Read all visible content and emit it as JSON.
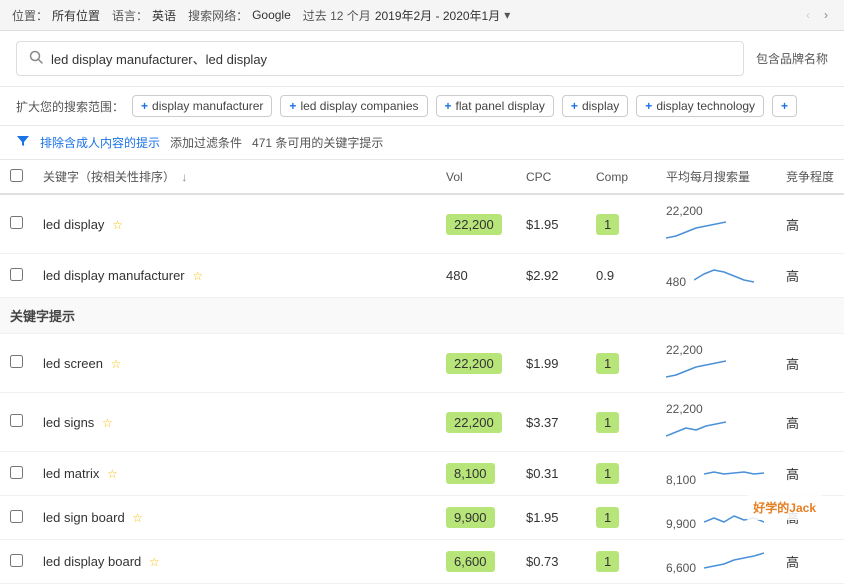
{
  "topbar": {
    "location_label": "位置：",
    "location_value": "所有位置",
    "language_label": "语言：",
    "language_value": "英语",
    "network_label": "搜索网络：",
    "network_value": "Google",
    "period_label": "过去 12 个月",
    "date_range": "2019年2月 - 2020年1月"
  },
  "searchbar": {
    "query": "led display manufacturer、led display",
    "brand_label": "包含品牌名称"
  },
  "expand": {
    "label": "扩大您的搜索范围：",
    "tags": [
      "display manufacturer",
      "led display companies",
      "flat panel display",
      "display",
      "display technology"
    ]
  },
  "filter": {
    "exclude_label": "排除含成人内容的提示",
    "add_filter_label": "添加过滤条件",
    "count_text": "471 条可用的关键字提示"
  },
  "table": {
    "headers": {
      "checkbox": "",
      "keyword": "关键字（按相关性排序）",
      "vol": "Vol",
      "cpc": "CPC",
      "comp": "Comp",
      "monthly": "平均每月搜索量",
      "comp_level": "竞争程度"
    },
    "keywords_section_label": "关键字提示",
    "rows": [
      {
        "id": "led-display",
        "keyword": "led display",
        "vol": "22,200",
        "vol_highlight": true,
        "cpc": "$1.95",
        "comp": "1",
        "comp_highlight": true,
        "monthly": "22,200",
        "comp_level": "高",
        "sparkline_type": "up"
      },
      {
        "id": "led-display-manufacturer",
        "keyword": "led display manufacturer",
        "vol": "480",
        "vol_highlight": false,
        "cpc": "$2.92",
        "comp": "0.9",
        "comp_highlight": false,
        "monthly": "480",
        "comp_level": "高",
        "sparkline_type": "hump"
      }
    ],
    "suggestion_rows": [
      {
        "id": "led-screen",
        "keyword": "led screen",
        "vol": "22,200",
        "vol_highlight": true,
        "cpc": "$1.99",
        "comp": "1",
        "comp_highlight": true,
        "monthly": "22,200",
        "comp_level": "高",
        "sparkline_type": "up"
      },
      {
        "id": "led-signs",
        "keyword": "led signs",
        "vol": "22,200",
        "vol_highlight": true,
        "cpc": "$3.37",
        "comp": "1",
        "comp_highlight": true,
        "monthly": "22,200",
        "comp_level": "高",
        "sparkline_type": "up2"
      },
      {
        "id": "led-matrix",
        "keyword": "led matrix",
        "vol": "8,100",
        "vol_highlight": true,
        "cpc": "$0.31",
        "comp": "1",
        "comp_highlight": true,
        "monthly": "8,100",
        "comp_level": "高",
        "sparkline_type": "flat"
      },
      {
        "id": "led-sign-board",
        "keyword": "led sign board",
        "vol": "9,900",
        "vol_highlight": true,
        "cpc": "$1.95",
        "comp": "1",
        "comp_highlight": true,
        "monthly": "9,900",
        "comp_level": "高",
        "sparkline_type": "zigzag"
      },
      {
        "id": "led-display-board",
        "keyword": "led display board",
        "vol": "6,600",
        "vol_highlight": true,
        "cpc": "$0.73",
        "comp": "1",
        "comp_highlight": true,
        "monthly": "6,600",
        "comp_level": "高",
        "sparkline_type": "up3"
      }
    ]
  },
  "watermark": {
    "text": "好学的Jack"
  }
}
